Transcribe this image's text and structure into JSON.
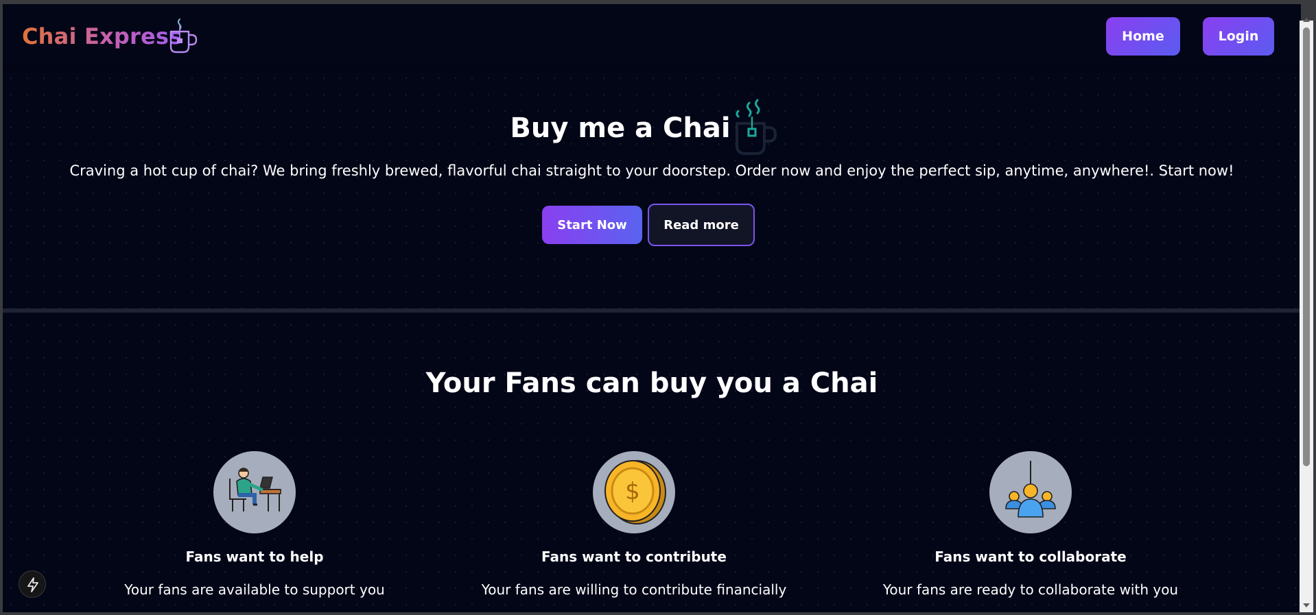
{
  "navbar": {
    "brand": "Chai Express",
    "brand_icon": "tea-mug-icon",
    "home_label": "Home",
    "login_label": "Login",
    "brand_gradient": [
      "#e0733a",
      "#c65fb0",
      "#9f5ff0"
    ],
    "button_gradient": [
      "#8a3ff0",
      "#5b5cf0"
    ]
  },
  "hero": {
    "title": "Buy me a Chai",
    "icon": "steaming-tea-mug-icon",
    "description": "Craving a hot cup of chai? We bring freshly brewed, flavorful chai straight to your doorstep. Order now and enjoy the perfect sip, anytime, anywhere!. Start now!",
    "start_label": "Start Now",
    "read_more_label": "Read more"
  },
  "fans": {
    "title": "Your Fans can buy you a Chai",
    "cards": [
      {
        "icon": "person-at-desk-icon",
        "title": "Fans want to help",
        "description": "Your fans are available to support you"
      },
      {
        "icon": "gold-coin-icon",
        "title": "Fans want to contribute",
        "description": "Your fans are willing to contribute financially"
      },
      {
        "icon": "group-collaborate-icon",
        "title": "Fans want to collaborate",
        "description": "Your fans are ready to collaborate with you"
      }
    ]
  },
  "floating_button": {
    "icon": "lightning-bolt-icon"
  },
  "colors": {
    "background": "#030617",
    "accent": "#8a3ff0",
    "icon_circle": "#a6adbc",
    "hero_mug": "#1aa89a"
  }
}
